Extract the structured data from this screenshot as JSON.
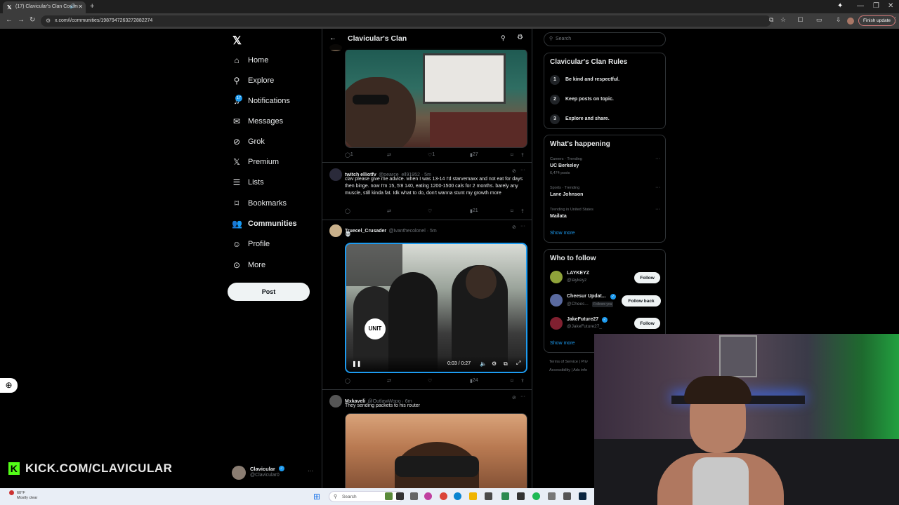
{
  "browser": {
    "tab_title": "(17) Clavicular's Clan Comm",
    "url": "x.com/i/communities/1987947263272882274",
    "finish_update": "Finish update"
  },
  "nav": {
    "items": [
      {
        "label": "Home",
        "icon": "home-icon"
      },
      {
        "label": "Explore",
        "icon": "search-icon"
      },
      {
        "label": "Notifications",
        "icon": "bell-icon"
      },
      {
        "label": "Messages",
        "icon": "mail-icon"
      },
      {
        "label": "Grok",
        "icon": "grok-icon"
      },
      {
        "label": "Premium",
        "icon": "x-icon"
      },
      {
        "label": "Lists",
        "icon": "list-icon"
      },
      {
        "label": "Bookmarks",
        "icon": "bookmark-icon"
      },
      {
        "label": "Communities",
        "icon": "people-icon"
      },
      {
        "label": "Profile",
        "icon": "person-icon"
      },
      {
        "label": "More",
        "icon": "more-icon"
      }
    ],
    "notif_count": "17",
    "post_label": "Post",
    "account_name": "Clavicular",
    "account_handle": "@Clavicular0"
  },
  "timeline": {
    "title": "Clavicular's Clan",
    "posts": [
      {
        "replies": "1",
        "likes": "1",
        "views": "27"
      },
      {
        "name": "twitch elliotfv",
        "handle": "@pearce_ell91952 · 5m",
        "text": "clav please give me advice. when I was 13-14 I'd starvemaxx and not eat for days then binge. now I'm 15, 5'8 140, eating 1200-1500 cals for 2 months. barely any muscle, still kinda fat. Idk what to do, don't wanna stunt my growth more",
        "views": "21"
      },
      {
        "name": "Truecel_Crusader",
        "handle": "@Ivanthecolonel · 5m",
        "text": "💀",
        "video_time": "0:03 / 0:27",
        "views": "24"
      },
      {
        "name": "Mxkaveli",
        "handle": "@OutlawWopo · 6m",
        "text": "They sending packets to his router"
      }
    ]
  },
  "right": {
    "search_placeholder": "Search",
    "rules_title": "Clavicular's Clan Rules",
    "rules": [
      {
        "num": "1",
        "text": "Be kind and respectful."
      },
      {
        "num": "2",
        "text": "Keep posts on topic."
      },
      {
        "num": "3",
        "text": "Explore and share."
      }
    ],
    "happening_title": "What's happening",
    "trends": [
      {
        "meta": "Careers · Trending",
        "name": "UC Berkeley",
        "count": "6,474 posts"
      },
      {
        "meta": "Sports · Trending",
        "name": "Lane Johnson",
        "count": ""
      },
      {
        "meta": "Trending in United States",
        "name": "Mailata",
        "count": ""
      }
    ],
    "show_more": "Show more",
    "wtf_title": "Who to follow",
    "follow": [
      {
        "name": "LAYKEYZ",
        "handle": "@laykeyz",
        "button": "Follow"
      },
      {
        "name": "Cheesur Updat...",
        "handle": "@Chees...",
        "follows_you": "Follows you",
        "button": "Follow back"
      },
      {
        "name": "JakeFuture27",
        "handle": "@JakeFuture27_",
        "button": "Follow"
      }
    ],
    "footer1": "Terms of Service  |  Priv",
    "footer2": "Accessibility  |  Ads info"
  },
  "overlay": {
    "kick_text": "KICK.COM/CLAVICULAR"
  },
  "taskbar": {
    "temp": "60°F",
    "weather": "Mostly clear",
    "search": "Search"
  },
  "colors": {
    "accent": "#1d9bf0",
    "kick_green": "#53fc18",
    "background": "#000000"
  }
}
